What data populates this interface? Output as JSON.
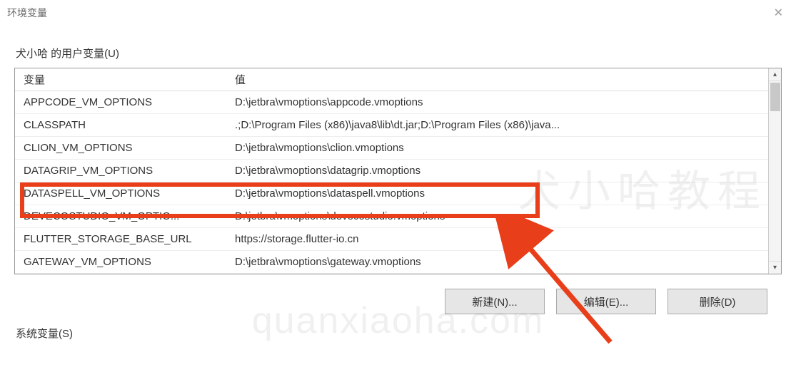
{
  "window": {
    "title": "环境变量"
  },
  "userVars": {
    "label": "犬小哈 的用户变量(U)",
    "header_var": "变量",
    "header_val": "值",
    "rows": [
      {
        "var": "APPCODE_VM_OPTIONS",
        "val": "D:\\jetbra\\vmoptions\\appcode.vmoptions"
      },
      {
        "var": "CLASSPATH",
        "val": ".;D:\\Program Files (x86)\\java8\\lib\\dt.jar;D:\\Program Files (x86)\\java..."
      },
      {
        "var": "CLION_VM_OPTIONS",
        "val": "D:\\jetbra\\vmoptions\\clion.vmoptions"
      },
      {
        "var": "DATAGRIP_VM_OPTIONS",
        "val": "D:\\jetbra\\vmoptions\\datagrip.vmoptions"
      },
      {
        "var": "DATASPELL_VM_OPTIONS",
        "val": "D:\\jetbra\\vmoptions\\dataspell.vmoptions"
      },
      {
        "var": "DEVECOSTUDIO_VM_OPTIO...",
        "val": "D:\\jetbra\\vmoptions\\devecostudio.vmoptions"
      },
      {
        "var": "FLUTTER_STORAGE_BASE_URL",
        "val": "https://storage.flutter-io.cn"
      },
      {
        "var": "GATEWAY_VM_OPTIONS",
        "val": "D:\\jetbra\\vmoptions\\gateway.vmoptions"
      }
    ]
  },
  "buttons": {
    "new": "新建(N)...",
    "edit": "编辑(E)...",
    "delete": "删除(D)"
  },
  "sysVars": {
    "label": "系统变量(S)"
  },
  "watermark": {
    "en": "quanxiaoha.com",
    "cn": "犬小哈教程"
  }
}
